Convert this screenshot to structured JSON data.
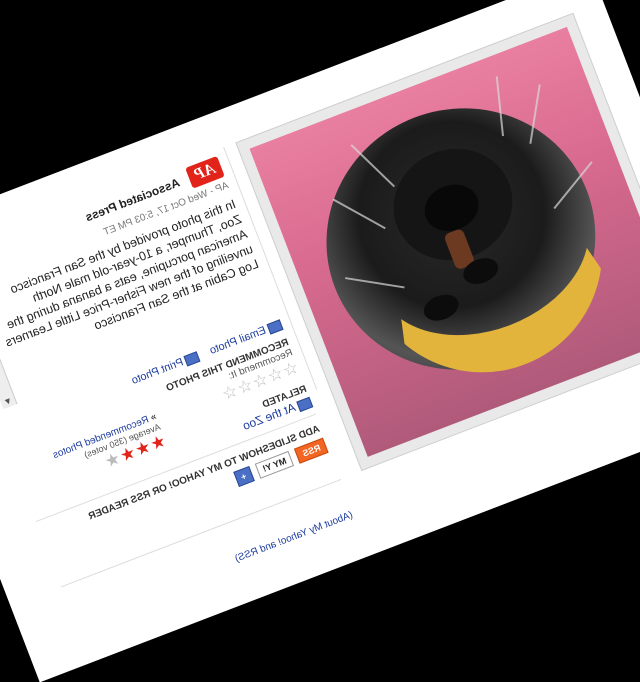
{
  "caption": {
    "source": "Associated Press",
    "dateline": "AP - Wed Oct 17, 5:03 PM ET",
    "text": "In this photo provided by the San Francisco Zoo, Thumper, a 10-year-old male North American porcupine, eats a banana during the unveiling of the new Fisher-Price Little Learners Log Cabin at the San Francisco"
  },
  "actions": {
    "email_label": "Email Photo",
    "print_label": "Print Photo",
    "recommend_head": "RECOMMEND THIS PHOTO",
    "recommend_sub": "Recommend It:",
    "recommended_link": "Recommended Photos",
    "average": "Average (350 votes)",
    "rating_stars": 3,
    "rating_max": 4
  },
  "related": {
    "heading": "RELATED",
    "link": "At the Zoo"
  },
  "add_slideshow": {
    "heading": "ADD SLIDESHOW TO MY YAHOO! OR RSS READER",
    "rss_label": "RSS",
    "my_yahoo_label": "MY Y!",
    "plus_label": "+",
    "about_link": "(About My Yahoo! and RSS)"
  },
  "photo": {
    "alt_name": "porcupine-eating-banana-photo"
  }
}
